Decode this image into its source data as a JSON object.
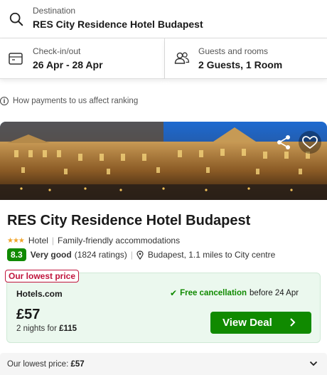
{
  "search": {
    "destination_label": "Destination",
    "destination_value": "RES City Residence Hotel Budapest",
    "dates_label": "Check-in/out",
    "dates_value": "26 Apr - 28 Apr",
    "guests_label": "Guests and rooms",
    "guests_value": "2 Guests, 1 Room"
  },
  "payment_note": "How payments to us affect ranking",
  "hotel": {
    "name": "RES City Residence Hotel Budapest",
    "type": "Hotel",
    "tag": "Family-friendly accommodations",
    "score": "8.3",
    "rating_word": "Very good",
    "ratings_count": "(1824 ratings)",
    "location": "Budapest, 1.1 miles to City centre",
    "star_count": 3
  },
  "deal": {
    "badge": "Our lowest price",
    "provider": "Hotels.com",
    "free_cancel": "Free cancellation",
    "cancel_before": "before 24 Apr",
    "price": "£57",
    "nights_text": "2 nights for",
    "total": "£115",
    "button": "View Deal"
  },
  "lowest_bar": {
    "label": "Our lowest price:",
    "price": "£57"
  },
  "colors": {
    "brand_green": "#108a00",
    "badge_red": "#c0143c",
    "star": "#f0a42a"
  }
}
